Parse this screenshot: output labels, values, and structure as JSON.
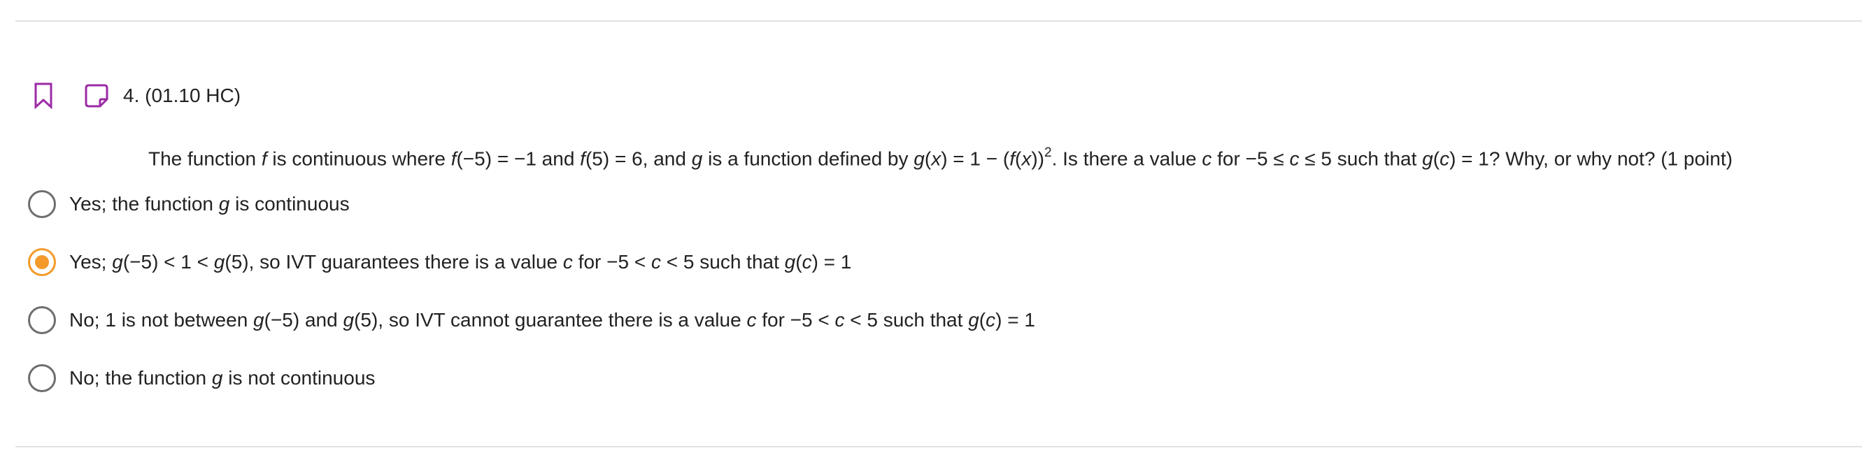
{
  "question": {
    "number_label": "4. (01.10 HC)",
    "prompt": {
      "p1": "The function ",
      "f1": "f",
      "p2": " is continuous where ",
      "f2": "f",
      "p3": "(−5) = −1 and ",
      "f3": "f",
      "p4": "(5) = 6, and ",
      "g1": "g",
      "p5": " is a function defined by ",
      "g2": "g",
      "p6": "(",
      "x1": "x",
      "p7": ") = 1 − (",
      "f4": "f",
      "p8": "(",
      "x2": "x",
      "p9": "))",
      "exp": "2",
      "p10": ". Is there a value ",
      "c1": "c",
      "p11": " for −5 ≤ ",
      "c2": "c",
      "p12": " ≤ 5 such that ",
      "g3": "g",
      "p13": "(",
      "c3": "c",
      "p14": ") = 1? Why, or why not? (1 point)"
    }
  },
  "options": [
    {
      "selected": false,
      "parts": {
        "a": "Yes; the function ",
        "b": "g",
        "c": " is continuous"
      }
    },
    {
      "selected": true,
      "parts": {
        "a": "Yes; ",
        "b": "g",
        "c": "(−5) < 1 < ",
        "d": "g",
        "e": "(5), so IVT guarantees there is a value ",
        "f": "c",
        "g": " for −5 < ",
        "h": "c",
        "i": " < 5 such that ",
        "j": "g",
        "k": "(",
        "l": "c",
        "m": ") = 1"
      }
    },
    {
      "selected": false,
      "parts": {
        "a": "No; 1 is not between ",
        "b": "g",
        "c": "(−5) and ",
        "d": "g",
        "e": "(5), so IVT cannot guarantee there is a value ",
        "f": "c",
        "g": " for −5 < ",
        "h": "c",
        "i": " < 5 such that ",
        "j": "g",
        "k": "(",
        "l": "c",
        "m": ") = 1"
      }
    },
    {
      "selected": false,
      "parts": {
        "a": "No; the function ",
        "b": "g",
        "c": " is not continuous"
      }
    }
  ],
  "icons": {
    "bookmark": "bookmark-icon",
    "note": "note-icon"
  },
  "colors": {
    "icon_accent": "#9b2aa6",
    "selected_accent": "#f39a2b",
    "radio_border": "#6e6e6e",
    "divider": "#e2e2e2"
  }
}
